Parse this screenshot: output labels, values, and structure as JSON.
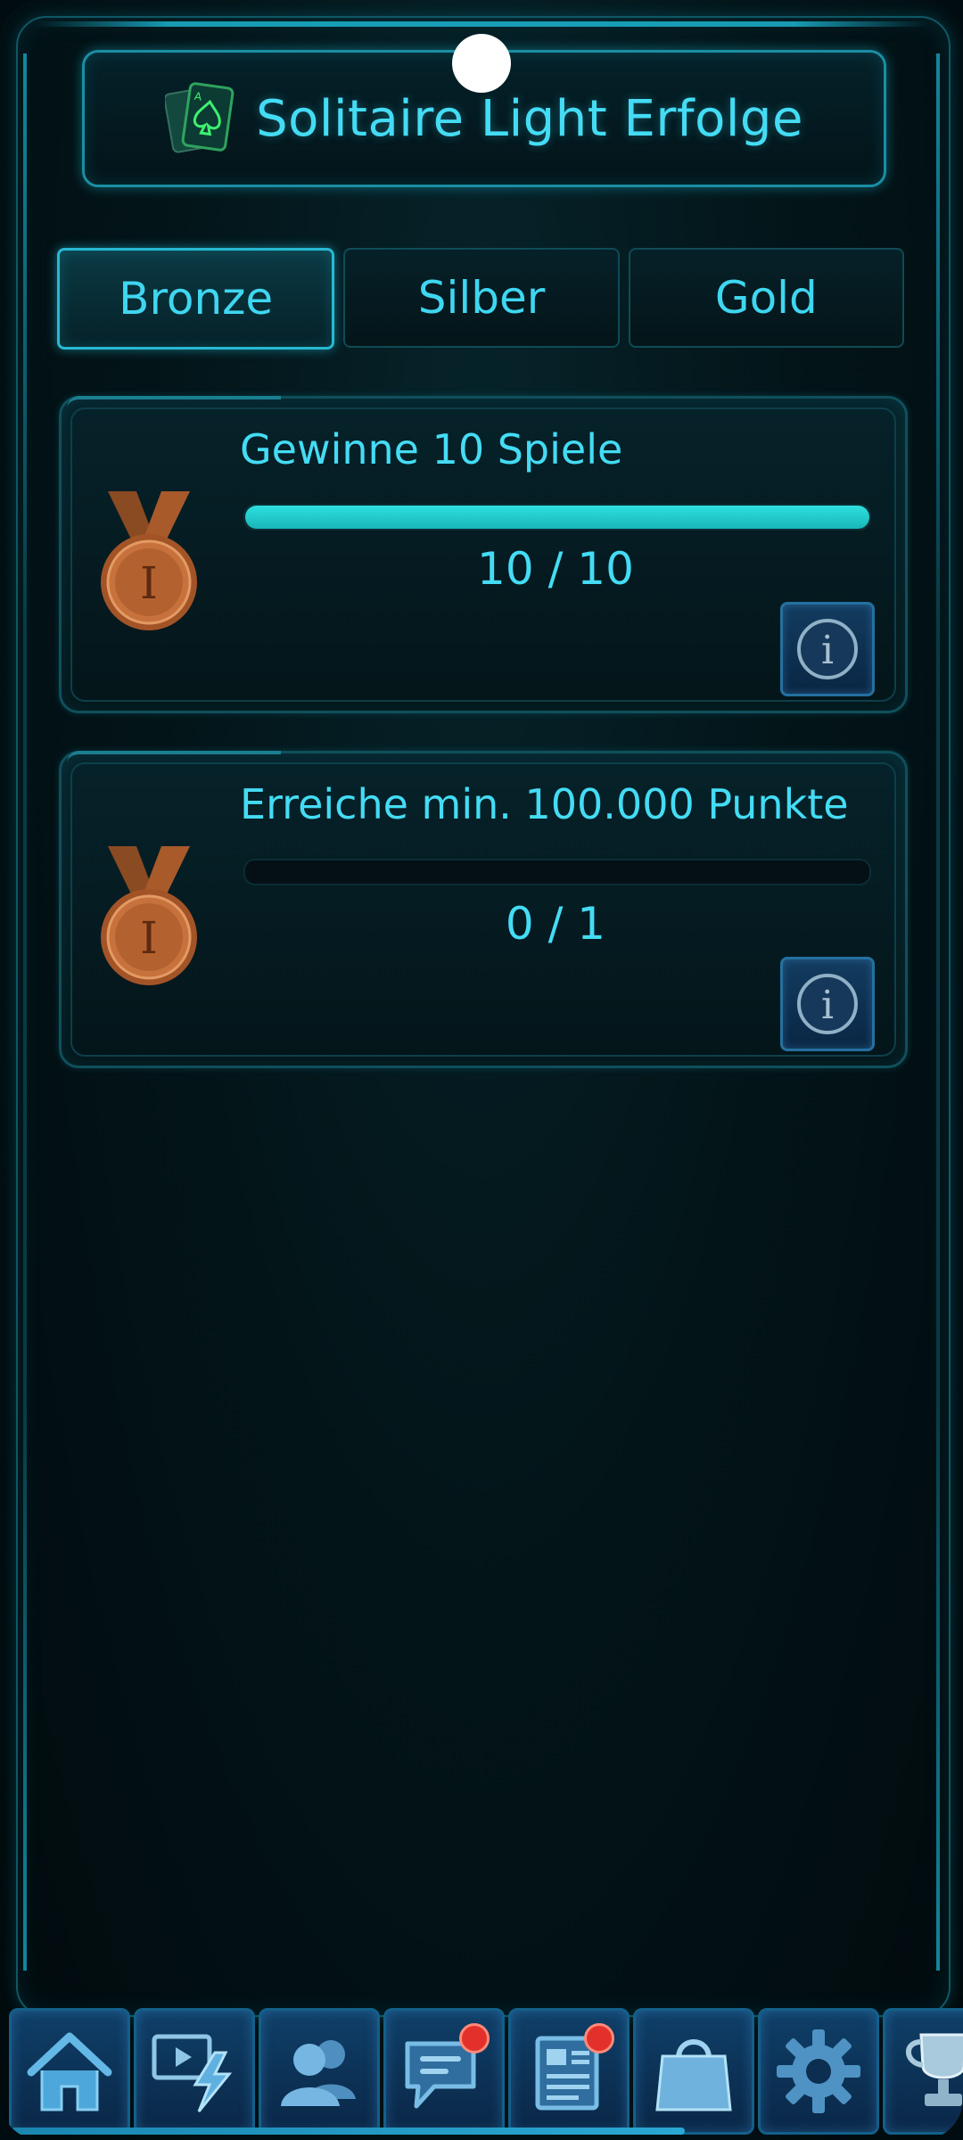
{
  "header": {
    "title": "Solitaire Light Erfolge",
    "icon": "cards-spade-icon"
  },
  "tabs": [
    {
      "label": "Bronze",
      "active": true
    },
    {
      "label": "Silber",
      "active": false
    },
    {
      "label": "Gold",
      "active": false
    }
  ],
  "achievements": [
    {
      "title": "Gewinne 10 Spiele",
      "progress_text": "10 / 10",
      "progress_fraction": 1.0,
      "medal": "bronze-medal-icon",
      "medal_numeral": "I"
    },
    {
      "title": "Erreiche min. 100.000 Punkte",
      "progress_text": "0 / 1",
      "progress_fraction": 0.0,
      "medal": "bronze-medal-icon",
      "medal_numeral": "I"
    }
  ],
  "info_icon_glyph": "i",
  "bottom_nav": [
    {
      "icon": "home-icon",
      "badge": false
    },
    {
      "icon": "video-lightning-icon",
      "badge": false
    },
    {
      "icon": "friends-icon",
      "badge": false
    },
    {
      "icon": "chat-icon",
      "badge": true
    },
    {
      "icon": "news-icon",
      "badge": true
    },
    {
      "icon": "shop-bag-icon",
      "badge": false
    },
    {
      "icon": "settings-gear-icon",
      "badge": false
    },
    {
      "icon": "trophy-icon",
      "badge": false
    }
  ],
  "colors": {
    "accent": "#44dcf4",
    "progress": "#2ee0df",
    "bronze": "#b8652f",
    "badge": "#e3302b",
    "background": "#021317"
  }
}
